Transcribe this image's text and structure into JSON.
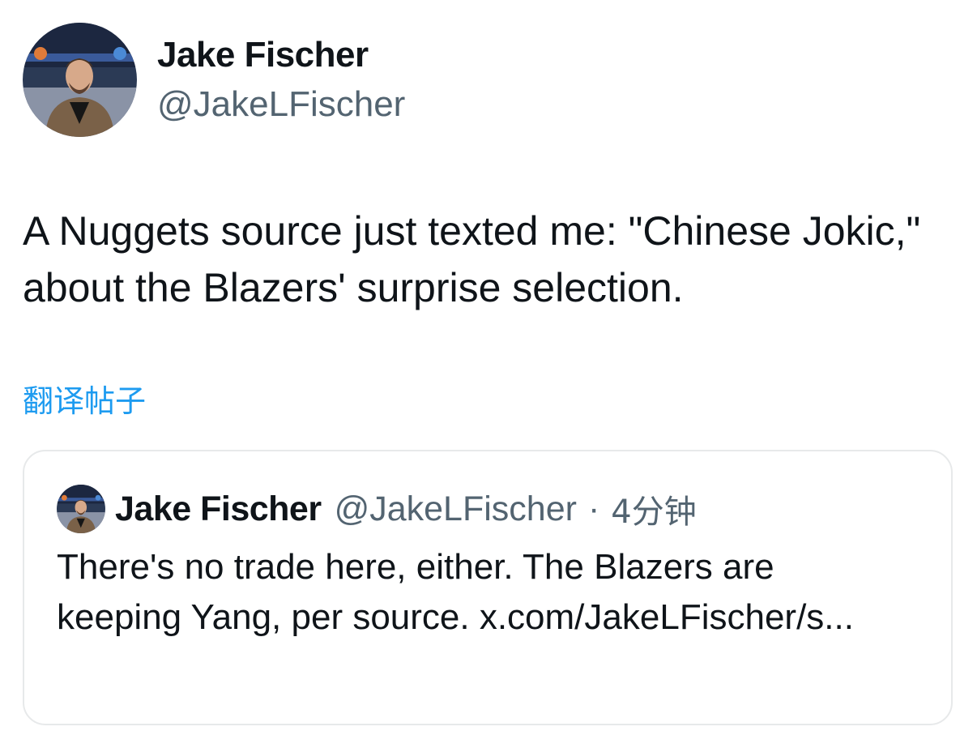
{
  "author": {
    "display_name": "Jake Fischer",
    "handle": "@JakeLFischer"
  },
  "tweet": {
    "text": "A Nuggets source just texted me: \"Chinese Jokic,\" about the Blazers' surprise selection.",
    "translate_label": "翻译帖子"
  },
  "quoted_tweet": {
    "display_name": "Jake Fischer",
    "handle": "@JakeLFischer",
    "separator": "·",
    "time": "4分钟",
    "text": "There's no trade here, either. The Blazers are keeping Yang, per source. x.com/JakeLFischer/s..."
  },
  "colors": {
    "link": "#1d9bf0",
    "secondary_text": "#536471",
    "border": "#e7e9ea"
  }
}
